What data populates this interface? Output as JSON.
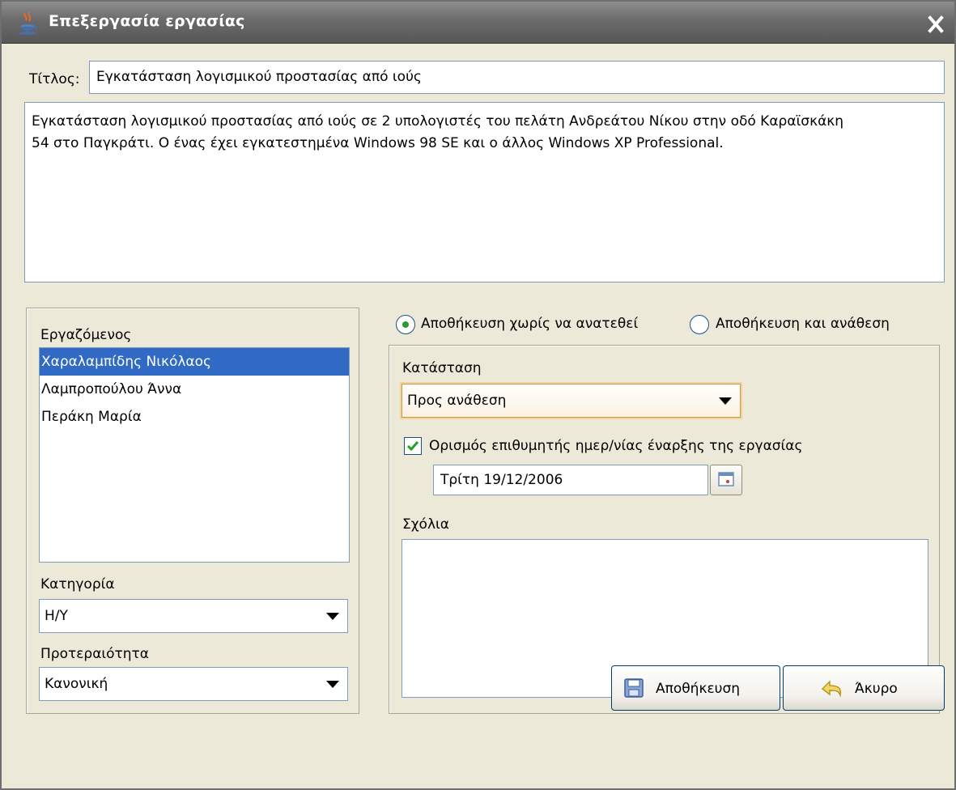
{
  "window": {
    "title": "Επεξεργασία εργασίας"
  },
  "title_field": {
    "label": "Τίτλος:",
    "value": "Εγκατάσταση λογισμικού προστασίας από ιούς"
  },
  "description": {
    "line1": "Εγκατάσταση λογισμικού προστασίας από ιούς σε 2 υπολογιστές του πελάτη Ανδρεάτου Νίκου στην οδό Καραϊσκάκη",
    "line2": "54 στο Παγκράτι. Ο ένας έχει εγκατεστημένα Windows 98 SE και ο άλλος Windows XP Professional."
  },
  "employees": {
    "label": "Εργαζόμενος",
    "items": [
      "Χαραλαμπίδης Νικόλαος",
      "Λαμπροπούλου Άννα",
      "Περάκη Μαρία"
    ],
    "selected_index": 0
  },
  "category": {
    "label": "Κατηγορία",
    "value": "Η/Υ"
  },
  "priority": {
    "label": "Προτεραιότητα",
    "value": "Κανονική"
  },
  "assignment": {
    "option_no_assign": "Αποθήκευση χωρίς να ανατεθεί",
    "option_assign": "Αποθήκευση και ανάθεση",
    "selected": "option_no_assign"
  },
  "status": {
    "label": "Κατάσταση",
    "value": "Προς ανάθεση"
  },
  "start_date": {
    "checkbox_label": "Ορισμός επιθυμητής ημερ/νίας έναρξης της εργασίας",
    "checked": true,
    "value": "Τρίτη 19/12/2006"
  },
  "comments": {
    "label": "Σχόλια",
    "value": ""
  },
  "buttons": {
    "save": "Αποθήκευση",
    "cancel": "Άκυρο"
  },
  "colors": {
    "selection": "#316ac5",
    "radio_dot": "#2a9a34",
    "titlebar": "#6a6a6a"
  }
}
